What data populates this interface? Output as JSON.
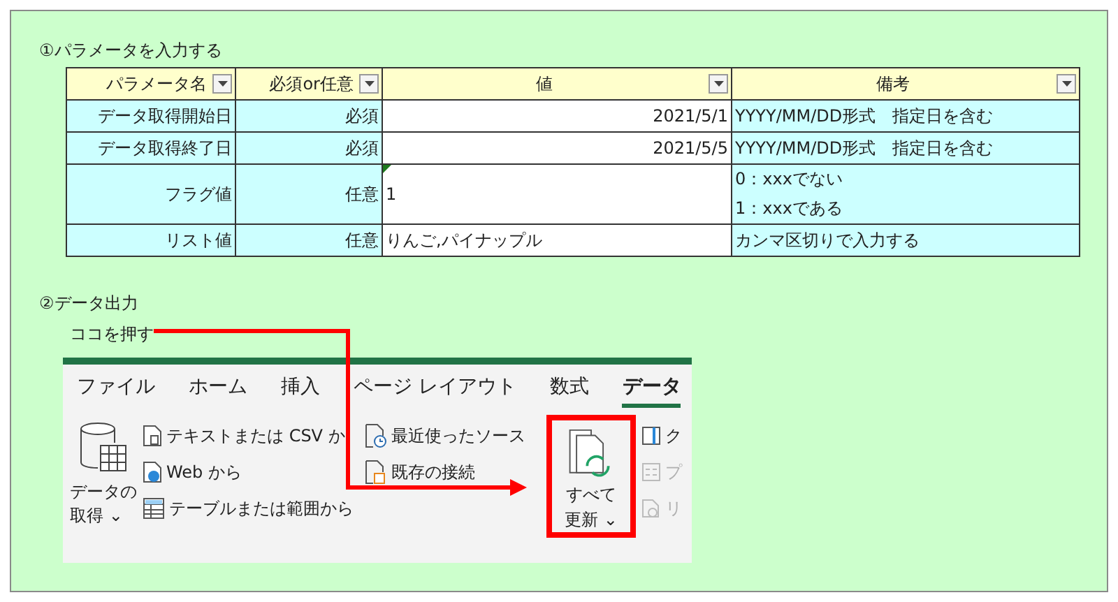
{
  "section_1": {
    "heading": "①パラメータを入力する"
  },
  "table": {
    "columns": [
      {
        "label": "パラメータ名",
        "filter_button": true
      },
      {
        "label": "必須or任意",
        "filter_button": true
      },
      {
        "label": "値",
        "filter_button": true
      },
      {
        "label": "備考",
        "filter_button": true
      }
    ],
    "rows": [
      {
        "name": "データ取得開始日",
        "required": "必須",
        "value": "2021/5/1",
        "kind": "number",
        "error_indicator": false,
        "notes": [
          "YYYY/MM/DD形式　指定日を含む"
        ]
      },
      {
        "name": "データ取得終了日",
        "required": "必須",
        "value": "2021/5/5",
        "kind": "number",
        "error_indicator": false,
        "notes": [
          "YYYY/MM/DD形式　指定日を含む"
        ]
      },
      {
        "name": "フラグ値",
        "required": "任意",
        "value": "1",
        "kind": "text",
        "error_indicator": true,
        "notes": [
          "0：xxxでない",
          "1：xxxである"
        ]
      },
      {
        "name": "リスト値",
        "required": "任意",
        "value": "りんご,パイナップル",
        "kind": "text",
        "error_indicator": false,
        "notes": [
          "カンマ区切りで入力する"
        ]
      }
    ]
  },
  "section_2": {
    "heading": "②データ出力",
    "callout": "ココを押す"
  },
  "ribbon": {
    "tabs": [
      {
        "label": "ファイル",
        "selected": false
      },
      {
        "label": "ホーム",
        "selected": false
      },
      {
        "label": "挿入",
        "selected": false
      },
      {
        "label": "ページ レイアウト",
        "selected": false
      },
      {
        "label": "数式",
        "selected": false
      },
      {
        "label": "データ",
        "selected": true
      }
    ],
    "get_data_button": {
      "lines": [
        "データの",
        "取得"
      ],
      "caret": "⌄"
    },
    "source_items": [
      {
        "label": "テキストまたは CSV か",
        "kind": "text-file",
        "disabled": false
      },
      {
        "label": "Web から",
        "kind": "web",
        "disabled": false
      },
      {
        "label": "テーブルまたは範囲から",
        "kind": "table",
        "disabled": false
      }
    ],
    "recent_items": [
      {
        "label": "最近使ったソース",
        "kind": "recent",
        "disabled": false
      },
      {
        "label": "既存の接続",
        "kind": "connection",
        "disabled": false
      }
    ],
    "refresh_all_button": {
      "lines": [
        "すべて",
        "更新"
      ],
      "caret": "⌄",
      "highlighted": true
    },
    "query_items": [
      {
        "label": "ク",
        "kind": "queries",
        "disabled": false
      },
      {
        "label": "プ",
        "kind": "properties",
        "disabled": true
      },
      {
        "label": "リ",
        "kind": "links",
        "disabled": true
      }
    ]
  }
}
